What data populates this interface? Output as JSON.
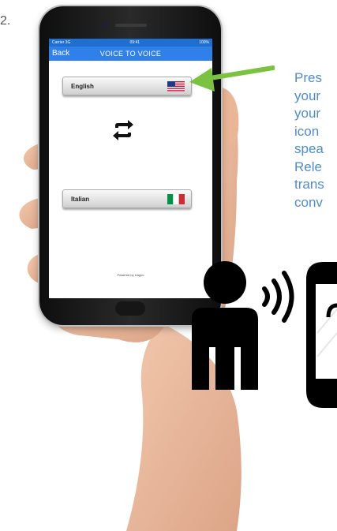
{
  "step_number": "2.",
  "app": {
    "status_left": "Carrier 3G",
    "status_time": "09:41",
    "status_right": "100%",
    "back_label": "Back",
    "title": "VOICE TO VOICE",
    "source_language": "English",
    "target_language": "Italian",
    "powered_by": "Powered by Lingvo"
  },
  "instructions": {
    "lines": [
      "Pres",
      "your",
      "your",
      "icon",
      "spea",
      "Rele",
      "trans",
      "conv"
    ]
  },
  "colors": {
    "nav_blue": "#2f80e8",
    "instruction_blue": "#4f8cc8",
    "arrow_green": "#7cc242"
  },
  "icons": [
    "us-flag-icon",
    "italy-flag-icon",
    "swap-icon",
    "arrow-icon",
    "person-speaking-icon",
    "phone-outline-icon"
  ]
}
